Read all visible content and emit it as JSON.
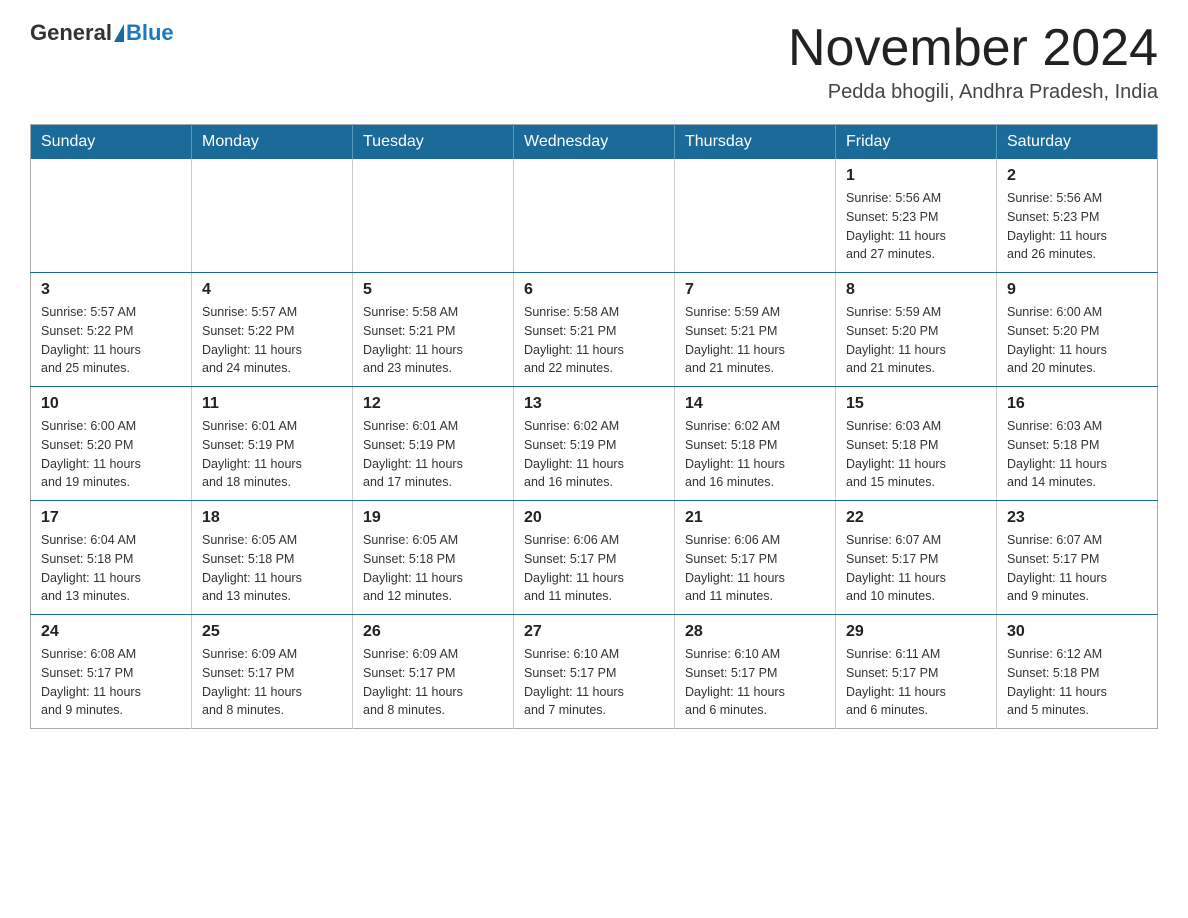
{
  "header": {
    "logo_general": "General",
    "logo_blue": "Blue",
    "month_title": "November 2024",
    "location": "Pedda bhogili, Andhra Pradesh, India"
  },
  "weekdays": [
    "Sunday",
    "Monday",
    "Tuesday",
    "Wednesday",
    "Thursday",
    "Friday",
    "Saturday"
  ],
  "weeks": [
    [
      {
        "day": "",
        "info": ""
      },
      {
        "day": "",
        "info": ""
      },
      {
        "day": "",
        "info": ""
      },
      {
        "day": "",
        "info": ""
      },
      {
        "day": "",
        "info": ""
      },
      {
        "day": "1",
        "info": "Sunrise: 5:56 AM\nSunset: 5:23 PM\nDaylight: 11 hours\nand 27 minutes."
      },
      {
        "day": "2",
        "info": "Sunrise: 5:56 AM\nSunset: 5:23 PM\nDaylight: 11 hours\nand 26 minutes."
      }
    ],
    [
      {
        "day": "3",
        "info": "Sunrise: 5:57 AM\nSunset: 5:22 PM\nDaylight: 11 hours\nand 25 minutes."
      },
      {
        "day": "4",
        "info": "Sunrise: 5:57 AM\nSunset: 5:22 PM\nDaylight: 11 hours\nand 24 minutes."
      },
      {
        "day": "5",
        "info": "Sunrise: 5:58 AM\nSunset: 5:21 PM\nDaylight: 11 hours\nand 23 minutes."
      },
      {
        "day": "6",
        "info": "Sunrise: 5:58 AM\nSunset: 5:21 PM\nDaylight: 11 hours\nand 22 minutes."
      },
      {
        "day": "7",
        "info": "Sunrise: 5:59 AM\nSunset: 5:21 PM\nDaylight: 11 hours\nand 21 minutes."
      },
      {
        "day": "8",
        "info": "Sunrise: 5:59 AM\nSunset: 5:20 PM\nDaylight: 11 hours\nand 21 minutes."
      },
      {
        "day": "9",
        "info": "Sunrise: 6:00 AM\nSunset: 5:20 PM\nDaylight: 11 hours\nand 20 minutes."
      }
    ],
    [
      {
        "day": "10",
        "info": "Sunrise: 6:00 AM\nSunset: 5:20 PM\nDaylight: 11 hours\nand 19 minutes."
      },
      {
        "day": "11",
        "info": "Sunrise: 6:01 AM\nSunset: 5:19 PM\nDaylight: 11 hours\nand 18 minutes."
      },
      {
        "day": "12",
        "info": "Sunrise: 6:01 AM\nSunset: 5:19 PM\nDaylight: 11 hours\nand 17 minutes."
      },
      {
        "day": "13",
        "info": "Sunrise: 6:02 AM\nSunset: 5:19 PM\nDaylight: 11 hours\nand 16 minutes."
      },
      {
        "day": "14",
        "info": "Sunrise: 6:02 AM\nSunset: 5:18 PM\nDaylight: 11 hours\nand 16 minutes."
      },
      {
        "day": "15",
        "info": "Sunrise: 6:03 AM\nSunset: 5:18 PM\nDaylight: 11 hours\nand 15 minutes."
      },
      {
        "day": "16",
        "info": "Sunrise: 6:03 AM\nSunset: 5:18 PM\nDaylight: 11 hours\nand 14 minutes."
      }
    ],
    [
      {
        "day": "17",
        "info": "Sunrise: 6:04 AM\nSunset: 5:18 PM\nDaylight: 11 hours\nand 13 minutes."
      },
      {
        "day": "18",
        "info": "Sunrise: 6:05 AM\nSunset: 5:18 PM\nDaylight: 11 hours\nand 13 minutes."
      },
      {
        "day": "19",
        "info": "Sunrise: 6:05 AM\nSunset: 5:18 PM\nDaylight: 11 hours\nand 12 minutes."
      },
      {
        "day": "20",
        "info": "Sunrise: 6:06 AM\nSunset: 5:17 PM\nDaylight: 11 hours\nand 11 minutes."
      },
      {
        "day": "21",
        "info": "Sunrise: 6:06 AM\nSunset: 5:17 PM\nDaylight: 11 hours\nand 11 minutes."
      },
      {
        "day": "22",
        "info": "Sunrise: 6:07 AM\nSunset: 5:17 PM\nDaylight: 11 hours\nand 10 minutes."
      },
      {
        "day": "23",
        "info": "Sunrise: 6:07 AM\nSunset: 5:17 PM\nDaylight: 11 hours\nand 9 minutes."
      }
    ],
    [
      {
        "day": "24",
        "info": "Sunrise: 6:08 AM\nSunset: 5:17 PM\nDaylight: 11 hours\nand 9 minutes."
      },
      {
        "day": "25",
        "info": "Sunrise: 6:09 AM\nSunset: 5:17 PM\nDaylight: 11 hours\nand 8 minutes."
      },
      {
        "day": "26",
        "info": "Sunrise: 6:09 AM\nSunset: 5:17 PM\nDaylight: 11 hours\nand 8 minutes."
      },
      {
        "day": "27",
        "info": "Sunrise: 6:10 AM\nSunset: 5:17 PM\nDaylight: 11 hours\nand 7 minutes."
      },
      {
        "day": "28",
        "info": "Sunrise: 6:10 AM\nSunset: 5:17 PM\nDaylight: 11 hours\nand 6 minutes."
      },
      {
        "day": "29",
        "info": "Sunrise: 6:11 AM\nSunset: 5:17 PM\nDaylight: 11 hours\nand 6 minutes."
      },
      {
        "day": "30",
        "info": "Sunrise: 6:12 AM\nSunset: 5:18 PM\nDaylight: 11 hours\nand 5 minutes."
      }
    ]
  ]
}
